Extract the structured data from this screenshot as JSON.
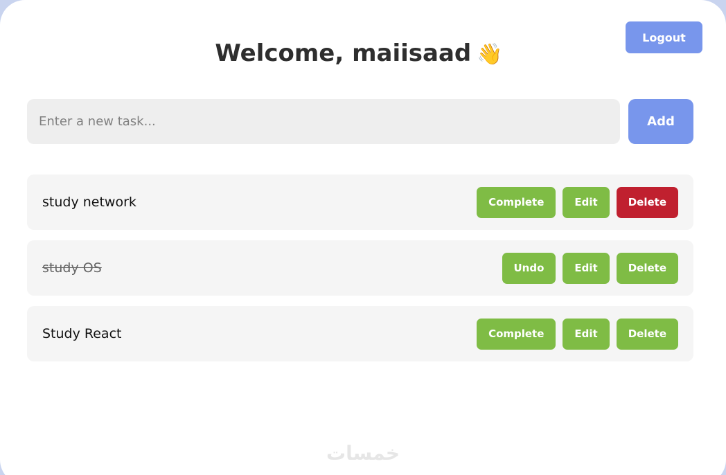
{
  "header": {
    "title": "Welcome, maiisaad",
    "wave_emoji": "👋",
    "logout_label": "Logout"
  },
  "new_task": {
    "placeholder": "Enter a new task...",
    "value": "",
    "add_label": "Add"
  },
  "tasks": [
    {
      "text": "study network",
      "completed": false,
      "toggle_label": "Complete",
      "edit_label": "Edit",
      "delete_label": "Delete",
      "delete_color": "#c0202f"
    },
    {
      "text": "study OS",
      "completed": true,
      "toggle_label": "Undo",
      "edit_label": "Edit",
      "delete_label": "Delete",
      "delete_color": "#7fbc45"
    },
    {
      "text": "Study React",
      "completed": false,
      "toggle_label": "Complete",
      "edit_label": "Edit",
      "delete_label": "Delete",
      "delete_color": "#7fbc45"
    }
  ],
  "watermark": "خمسات",
  "colors": {
    "accent": "#7896ec",
    "action_green": "#7fbc45",
    "danger_red": "#c0202f",
    "background": "#c9d4ef"
  }
}
